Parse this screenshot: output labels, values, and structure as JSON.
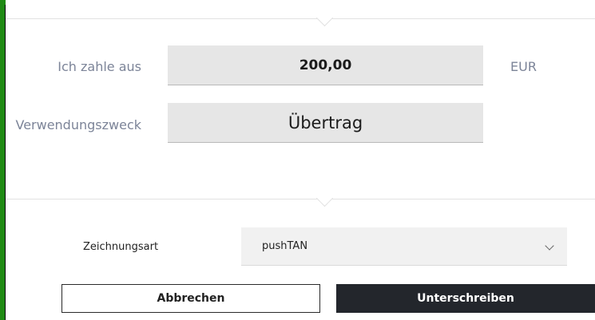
{
  "payout": {
    "label": "Ich zahle aus",
    "amount": "200,00",
    "currency": "EUR"
  },
  "purpose": {
    "label": "Verwendungszweck",
    "value": "Übertrag"
  },
  "signing": {
    "label": "Zeichnungsart",
    "selected": "pushTAN"
  },
  "actions": {
    "cancel_label": "Abbrechen",
    "sign_label": "Unterschreiben"
  }
}
